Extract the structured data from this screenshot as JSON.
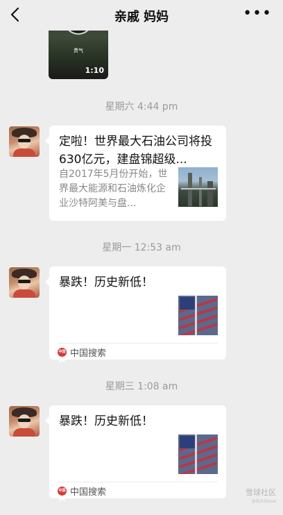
{
  "header": {
    "title": "亲戚 妈妈"
  },
  "video": {
    "overlay_text": "贵气",
    "duration": "1:10"
  },
  "messages": [
    {
      "timestamp": "星期六 4:44 pm",
      "title": "定啦！世界最大石油公司将投630亿元，建盘锦超级...",
      "description": "自2017年5月份开始，世界最大能源和石油炼化企业沙特阿美与盘..."
    },
    {
      "timestamp": "星期一 12:53 am",
      "title": "暴跌！历史新低！",
      "source": "中国搜索"
    },
    {
      "timestamp": "星期三 1:08 am",
      "title": "暴跌！历史新低！",
      "source": "中国搜索"
    }
  ],
  "source_icon_text": "中国搜索",
  "watermark": {
    "main": "雪球社区",
    "sub": "@石头Stone"
  },
  "icons": {
    "back": "chevron-left-icon",
    "more": "more-dots-icon",
    "source": "china-search-logo-icon"
  }
}
